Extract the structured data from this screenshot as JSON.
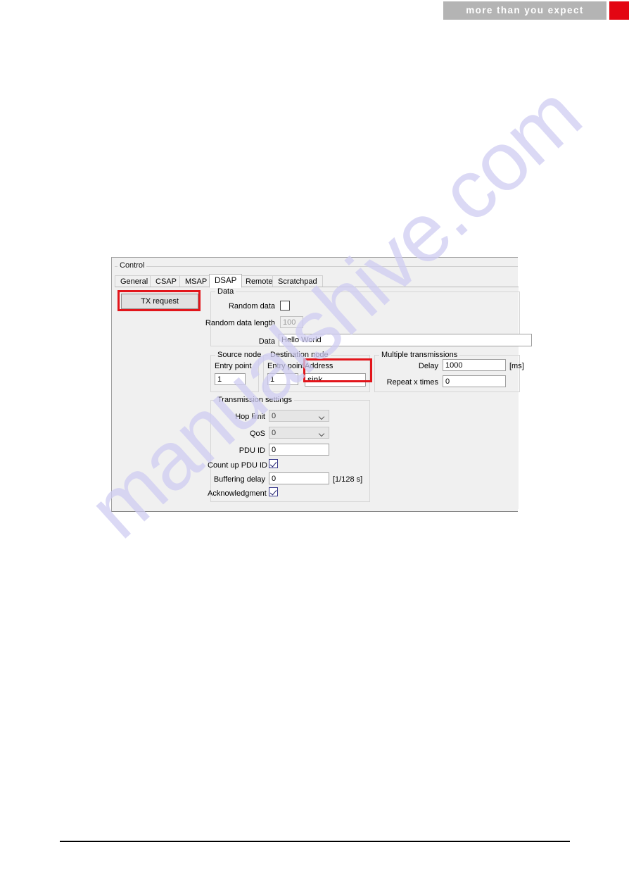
{
  "header": {
    "slogan": "more than you expect",
    "bar_color": "#b4b4b4",
    "accent_color": "#e30613"
  },
  "watermark": {
    "text": "manualshive.com",
    "color": "#cfcdf2"
  },
  "dialog": {
    "title": "Control",
    "tabs": [
      {
        "label": "General",
        "selected": false
      },
      {
        "label": "CSAP",
        "selected": false
      },
      {
        "label": "MSAP",
        "selected": false
      },
      {
        "label": "DSAP",
        "selected": true
      },
      {
        "label": "Remote",
        "selected": false
      },
      {
        "label": "Scratchpad",
        "selected": false
      }
    ],
    "tx_request_button": "TX request",
    "data_group": {
      "title": "Data",
      "random_data_label": "Random data",
      "random_data_checked": false,
      "random_data_length_label": "Random data length",
      "random_data_length_value": "100",
      "random_data_length_enabled": false,
      "data_label": "Data",
      "data_value": "Hello World"
    },
    "source_node_group": {
      "title": "Source node",
      "entry_point_label": "Entry point",
      "entry_point_value": "1"
    },
    "destination_node_group": {
      "title": "Destination node",
      "entry_point_label": "Entry point",
      "entry_point_value": "1",
      "address_label": "Address",
      "address_value": "sink"
    },
    "multiple_transmissions_group": {
      "title": "Multiple transmissions",
      "delay_label": "Delay",
      "delay_value": "1000",
      "delay_unit": "[ms]",
      "repeat_label": "Repeat x times",
      "repeat_value": "0"
    },
    "transmission_settings_group": {
      "title": "Transmission settings",
      "hop_limit_label": "Hop limit",
      "hop_limit_value": "0",
      "qos_label": "QoS",
      "qos_value": "0",
      "pdu_id_label": "PDU ID",
      "pdu_id_value": "0",
      "count_up_pdu_id_label": "Count up PDU ID",
      "count_up_pdu_id_checked": true,
      "buffering_delay_label": "Buffering delay",
      "buffering_delay_value": "0",
      "buffering_delay_unit": "[1/128 s]",
      "acknowledgment_label": "Acknowledgment",
      "acknowledgment_checked": true
    }
  },
  "annotations": {
    "highlight_color": "#e2151b"
  }
}
